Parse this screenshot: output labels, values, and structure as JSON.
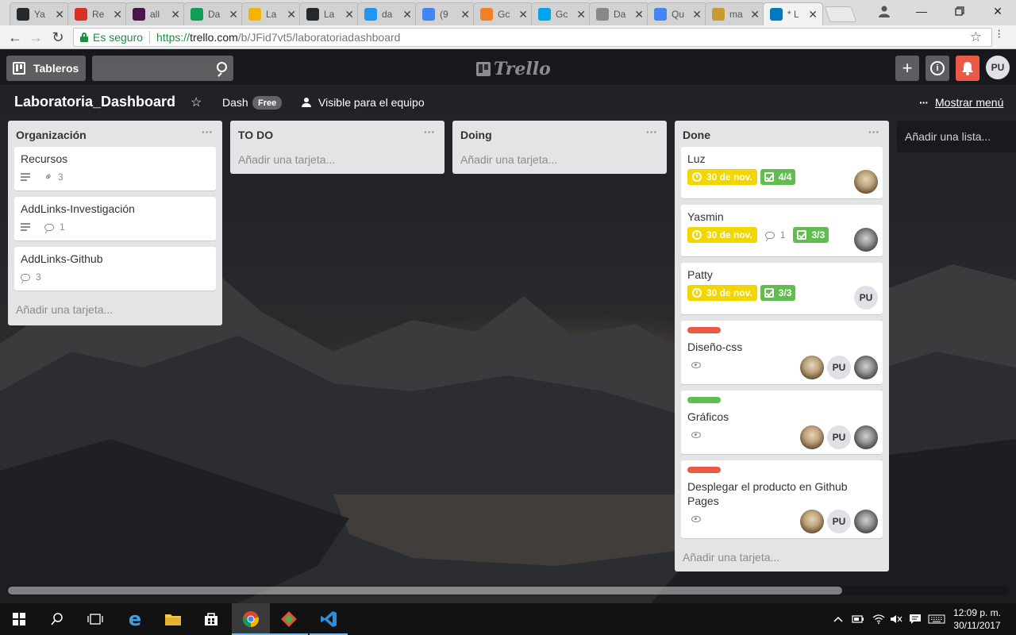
{
  "browser": {
    "tabs": [
      {
        "title": "Ya",
        "icon": "github-icon",
        "color": "#24292e"
      },
      {
        "title": "Re",
        "icon": "gmail-icon",
        "color": "#d93025"
      },
      {
        "title": "all",
        "icon": "slack-icon",
        "color": "#4a154b"
      },
      {
        "title": "Da",
        "icon": "sheets-icon",
        "color": "#0f9d58"
      },
      {
        "title": "La",
        "icon": "slides-icon",
        "color": "#f4b400"
      },
      {
        "title": "La",
        "icon": "github-icon",
        "color": "#24292e"
      },
      {
        "title": "da",
        "icon": "app-icon",
        "color": "#2196f3"
      },
      {
        "title": "(9",
        "icon": "docs-blue-icon",
        "color": "#4285f4"
      },
      {
        "title": "Gc",
        "icon": "stackoverflow-icon",
        "color": "#f48024"
      },
      {
        "title": "Gc",
        "icon": "windows-store-icon",
        "color": "#00a4ef"
      },
      {
        "title": "Da",
        "icon": "document-icon",
        "color": "#888888"
      },
      {
        "title": "Qu",
        "icon": "google-icon",
        "color": "#4285f4"
      },
      {
        "title": "ma",
        "icon": "keys-icon",
        "color": "#c99a2e"
      },
      {
        "title": "* L",
        "icon": "trello-icon",
        "color": "#0079bf"
      }
    ],
    "secure_label": "Es seguro",
    "url": {
      "scheme": "https://",
      "host": "trello.com",
      "path": "/b/JFid7vt5/laboratoriadashboard"
    }
  },
  "header": {
    "boards_label": "Tableros",
    "search_placeholder": "",
    "logo_text": "Trello",
    "avatar_initials": "PU"
  },
  "board": {
    "title": "Laboratoria_Dashboard",
    "team": "Dash",
    "plan_badge": "Free",
    "visibility": "Visible para el equipo",
    "show_menu": "Mostrar menú",
    "add_list": "Añadir una lista...",
    "add_card": "Añadir una tarjeta..."
  },
  "lists": [
    {
      "name": "Organización",
      "menu": "···",
      "cards": [
        {
          "title": "Recursos",
          "description": true,
          "attachments": "3"
        },
        {
          "title": "AddLinks-Investigación",
          "description": true,
          "comments": "1"
        },
        {
          "title": "AddLinks-Github",
          "comments": "3"
        }
      ]
    },
    {
      "name": "TO DO",
      "menu": "···",
      "cards": []
    },
    {
      "name": "Doing",
      "menu": "···",
      "cards": []
    },
    {
      "name": "Done",
      "menu": "···",
      "cards": [
        {
          "title": "Luz",
          "due": "30 de nov.",
          "checklist": "4/4",
          "members": [
            "photo-a"
          ]
        },
        {
          "title": "Yasmin",
          "due": "30 de nov.",
          "comments": "1",
          "checklist": "3/3",
          "members": [
            "photo-b"
          ]
        },
        {
          "title": "Patty",
          "due": "30 de nov.",
          "checklist": "3/3",
          "members": [
            "PU"
          ]
        },
        {
          "title": "Diseño-css",
          "label_color": "#eb5a46",
          "watching": true,
          "members": [
            "photo-a",
            "PU",
            "photo-b"
          ]
        },
        {
          "title": "Gráficos",
          "label_color": "#61bd4f",
          "watching": true,
          "members": [
            "photo-a",
            "PU",
            "photo-b"
          ]
        },
        {
          "title": "Desplegar el producto en Github Pages",
          "label_color": "#eb5a46",
          "watching": true,
          "members": [
            "photo-a",
            "PU",
            "photo-b"
          ]
        }
      ]
    }
  ],
  "taskbar": {
    "time": "12:09 p. m.",
    "date": "30/11/2017"
  },
  "colors": {
    "due": "#f2d600",
    "checklist_complete": "#61bd4f",
    "notification": "#eb5a46"
  }
}
